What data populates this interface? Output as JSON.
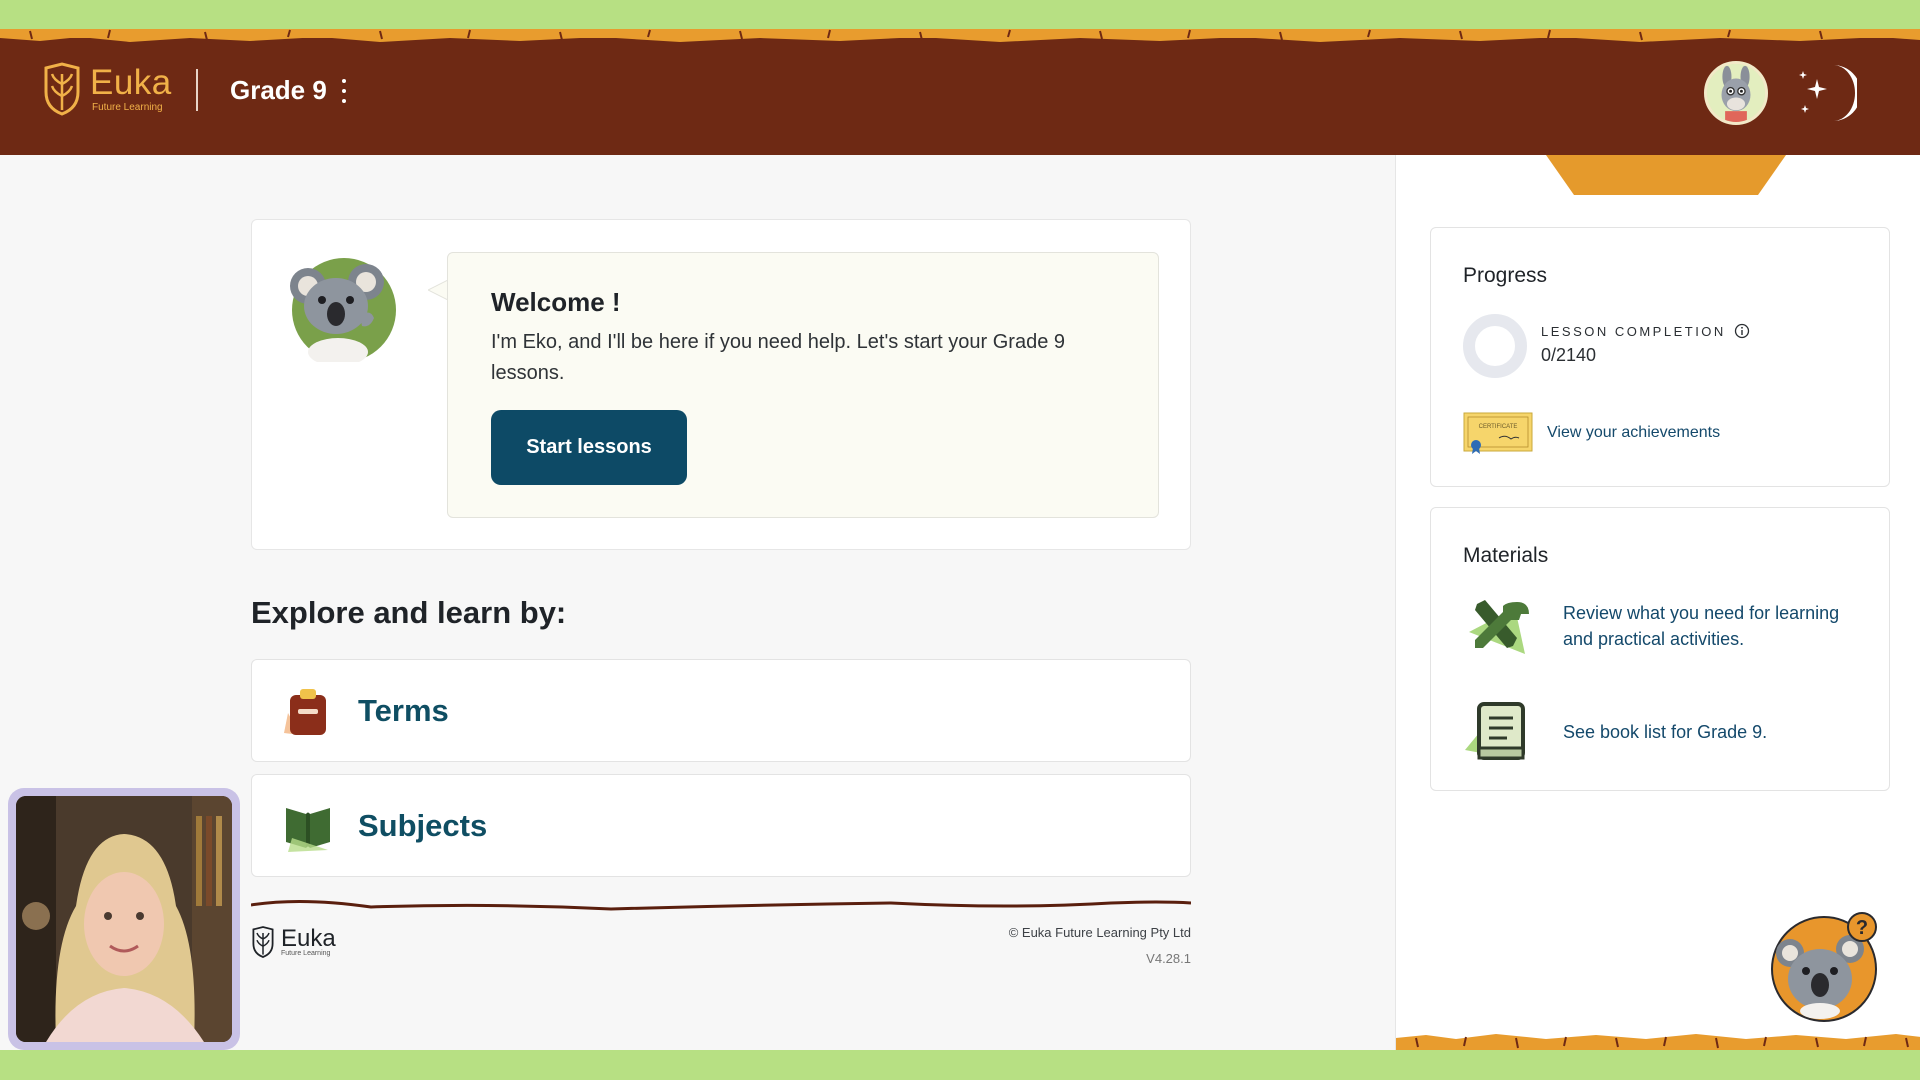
{
  "header": {
    "logo_name": "Euka",
    "logo_tagline": "Future Learning",
    "grade_title": "Grade 9",
    "colors": {
      "header_bg": "#6e2914",
      "logo": "#f1b148"
    }
  },
  "welcome": {
    "title": "Welcome !",
    "message": "I'm Eko, and I'll be here if you need help. Let's start your Grade 9 lessons.",
    "start_button": "Start lessons"
  },
  "explore": {
    "heading": "Explore and learn by:",
    "items": [
      {
        "label": "Terms",
        "icon": "clipboard-icon"
      },
      {
        "label": "Subjects",
        "icon": "open-book-icon"
      }
    ]
  },
  "progress": {
    "title": "Progress",
    "completion_label": "LESSON COMPLETION",
    "completion_value": "0/2140",
    "completion_done": 0,
    "completion_total": 2140,
    "achievements_link": "View your achievements",
    "certificate_text": "CERTIFICATE"
  },
  "materials": {
    "title": "Materials",
    "items": [
      {
        "text": "Review what you need for learning and practical activities.",
        "icon": "tools-icon"
      },
      {
        "text": "See book list for Grade 9.",
        "icon": "book-icon"
      }
    ]
  },
  "footer": {
    "logo_name": "Euka",
    "logo_tagline": "Future Learning",
    "copyright": "© Euka Future Learning Pty Ltd",
    "version": "V4.28.1"
  }
}
